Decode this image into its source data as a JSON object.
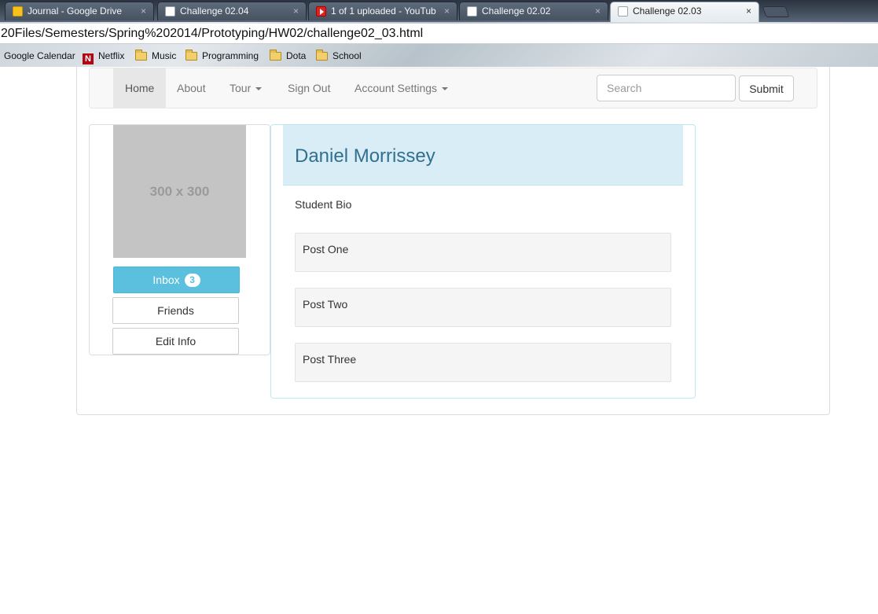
{
  "browser": {
    "tabs": [
      {
        "title": "Journal - Google Drive",
        "icon": "drive-icon",
        "active": false
      },
      {
        "title": "Challenge 02.04",
        "icon": "page-icon",
        "active": false
      },
      {
        "title": "1 of 1 uploaded - YouTub",
        "icon": "youtube-icon",
        "active": false
      },
      {
        "title": "Challenge 02.02",
        "icon": "page-icon",
        "active": false
      },
      {
        "title": "Challenge 02.03",
        "icon": "page-icon",
        "active": true
      }
    ],
    "close_glyph": "×",
    "address": "20Files/Semesters/Spring%202014/Prototyping/HW02/challenge02_03.html",
    "bookmarks": [
      {
        "label": "Google Calendar",
        "icon": "none"
      },
      {
        "label": "Netflix",
        "icon": "netflix-icon"
      },
      {
        "label": "Music",
        "icon": "folder-icon"
      },
      {
        "label": "Programming",
        "icon": "folder-icon"
      },
      {
        "label": "Dota",
        "icon": "folder-icon"
      },
      {
        "label": "School",
        "icon": "folder-icon"
      }
    ]
  },
  "navbar": {
    "items": [
      {
        "label": "Home",
        "active": true
      },
      {
        "label": "About"
      },
      {
        "label": "Tour",
        "dropdown": true
      },
      {
        "label": "Sign Out"
      },
      {
        "label": "Account Settings",
        "dropdown": true
      }
    ],
    "search_placeholder": "Search",
    "submit_label": "Submit"
  },
  "sidebar": {
    "image_placeholder": "300 x 300",
    "inbox_label": "Inbox",
    "inbox_count": "3",
    "friends_label": "Friends",
    "edit_label": "Edit Info"
  },
  "profile": {
    "name": "Daniel Morrissey",
    "bio": "Student Bio",
    "posts": [
      "Post One",
      "Post Two",
      "Post Three"
    ]
  },
  "colors": {
    "info_accent": "#5bc0de",
    "panel_heading_bg": "#d9edf7",
    "panel_heading_text": "#31708f"
  }
}
